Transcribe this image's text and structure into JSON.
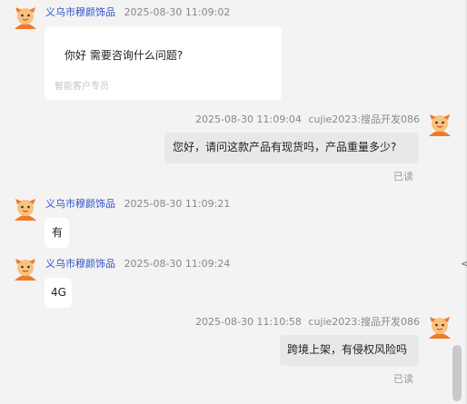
{
  "messages": [
    {
      "side": "left",
      "sender": "义乌市穆颜饰品",
      "time": "2025-08-30 11:09:02",
      "text": "你好 需要咨询什么问题?",
      "footer": "智能客户专员"
    },
    {
      "side": "right",
      "sender": "cujie2023:搜品开发086",
      "time": "2025-08-30 11:09:04",
      "text": "您好，请问这款产品有现货吗，产品重量多少?",
      "status": "已读"
    },
    {
      "side": "left",
      "sender": "义乌市穆颜饰品",
      "time": "2025-08-30 11:09:21",
      "text": "有"
    },
    {
      "side": "left",
      "sender": "义乌市穆颜饰品",
      "time": "2025-08-30 11:09:24",
      "text": "4G"
    },
    {
      "side": "right",
      "sender": "cujie2023:搜品开发086",
      "time": "2025-08-30 11:10:58",
      "text": "跨境上架，有侵权风险吗",
      "status": "已读"
    }
  ],
  "side_arrow": "<",
  "colors": {
    "sender": "#2f54c8",
    "avatar": "#f07a2a",
    "bubble_white": "#ffffff",
    "bubble_grey": "#e8e8e8",
    "background": "#f3f3f3"
  },
  "icons": {
    "avatar": "mascot-avatar-icon"
  }
}
